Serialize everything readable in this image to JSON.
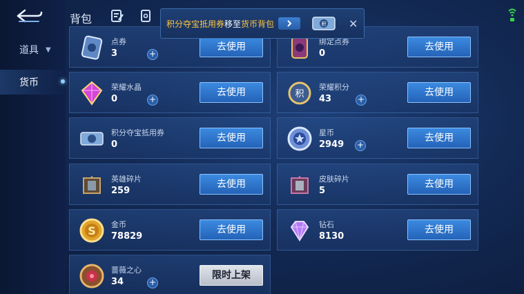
{
  "topbar": {
    "title": "背包"
  },
  "toast": {
    "item": "积分夺宝抵用券",
    "middle": "移至",
    "target": "货币背包",
    "go_icon": "chevron-right-icon",
    "close_icon": "close-icon"
  },
  "sidebar": {
    "items": [
      {
        "label": "道具",
        "arrow": "▼"
      },
      {
        "label": "货币"
      }
    ]
  },
  "cards": [
    {
      "name": "点券",
      "count": "3",
      "button": "去使用",
      "icon": "coupon-card-icon"
    },
    {
      "name": "绑定点券",
      "count": "0",
      "button": "去使用",
      "icon": "bound-coupon-icon"
    },
    {
      "name": "荣耀水晶",
      "count": "0",
      "button": "去使用",
      "icon": "honor-crystal-icon"
    },
    {
      "name": "荣耀积分",
      "count": "43",
      "button": "去使用",
      "icon": "honor-points-icon"
    },
    {
      "name": "积分夺宝抵用券",
      "count": "0",
      "button": "去使用",
      "icon": "lottery-voucher-icon"
    },
    {
      "name": "星币",
      "count": "2949",
      "button": "去使用",
      "icon": "star-coin-icon"
    },
    {
      "name": "英雄碎片",
      "count": "259",
      "button": "去使用",
      "icon": "hero-fragment-icon"
    },
    {
      "name": "皮肤碎片",
      "count": "5",
      "button": "去使用",
      "icon": "skin-fragment-icon"
    },
    {
      "name": "金币",
      "count": "78829",
      "button": "去使用",
      "icon": "gold-coin-icon"
    },
    {
      "name": "钻石",
      "count": "8130",
      "button": "去使用",
      "icon": "diamond-icon"
    },
    {
      "name": "蔷薇之心",
      "count": "34",
      "button": "限时上架",
      "icon": "rose-heart-icon"
    }
  ],
  "plus_symbol": "+",
  "colors": {
    "highlight": "#ffc63d",
    "button": "#2f76cc",
    "wifi": "#35d64a"
  }
}
